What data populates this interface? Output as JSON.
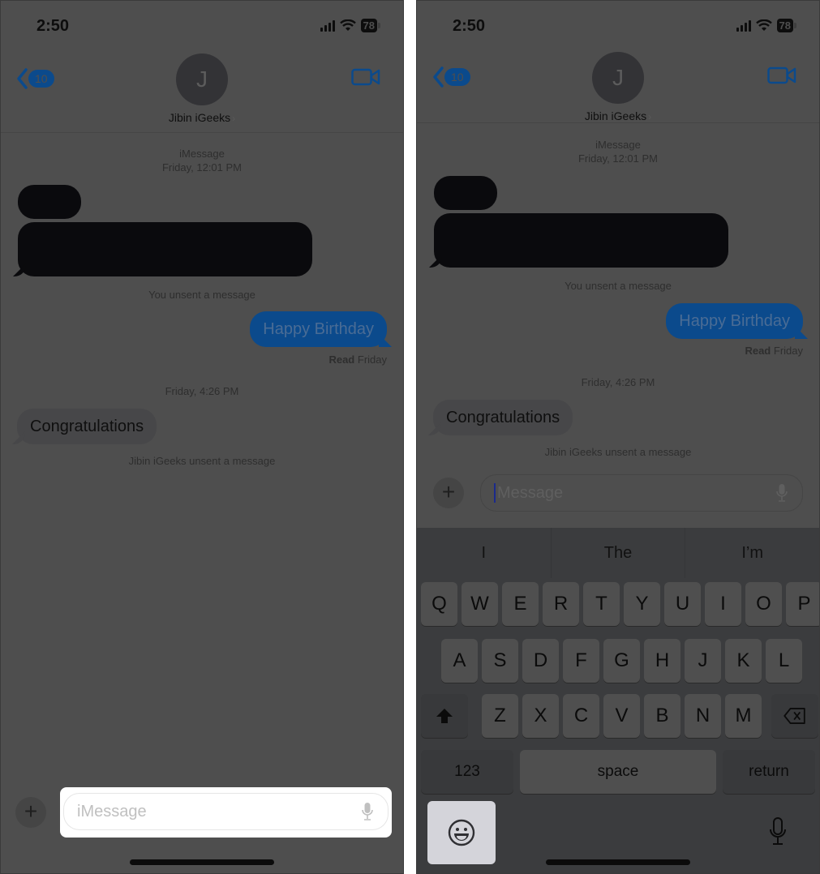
{
  "status_bar": {
    "time": "2:50",
    "battery": "78"
  },
  "nav": {
    "back_count": "10",
    "avatar_initial": "J",
    "contact_name": "Jibin iGeeks",
    "contact_chevron": "›"
  },
  "conversation": {
    "service_label": "iMessage",
    "first_timestamp": "Friday, 12:01 PM",
    "you_unsent": "You unsent a message",
    "sent_message": "Happy Birthday",
    "read_receipt_bold": "Read",
    "read_receipt_day": "Friday",
    "second_timestamp": "Friday, 4:26 PM",
    "received_message": "Congratulations",
    "contact_unsent": "Jibin iGeeks unsent a message"
  },
  "left_screen": {
    "input_placeholder": "iMessage",
    "plus_label": "+"
  },
  "right_screen": {
    "input_placeholder": "Message",
    "plus_label": "+",
    "suggestions": [
      "I",
      "The",
      "I’m"
    ],
    "keyboard": {
      "row1": [
        "Q",
        "W",
        "E",
        "R",
        "T",
        "Y",
        "U",
        "I",
        "O",
        "P"
      ],
      "row2": [
        "A",
        "S",
        "D",
        "F",
        "G",
        "H",
        "J",
        "K",
        "L"
      ],
      "row3": [
        "Z",
        "X",
        "C",
        "V",
        "B",
        "N",
        "M"
      ],
      "numbers_label": "123",
      "space_label": "space",
      "return_label": "return"
    }
  },
  "colors": {
    "screen_dim": "#4e4e4e",
    "accent_blue": "#0b4a8c",
    "highlight": "#ffffff",
    "emoji_highlight": "#d4d4da"
  }
}
